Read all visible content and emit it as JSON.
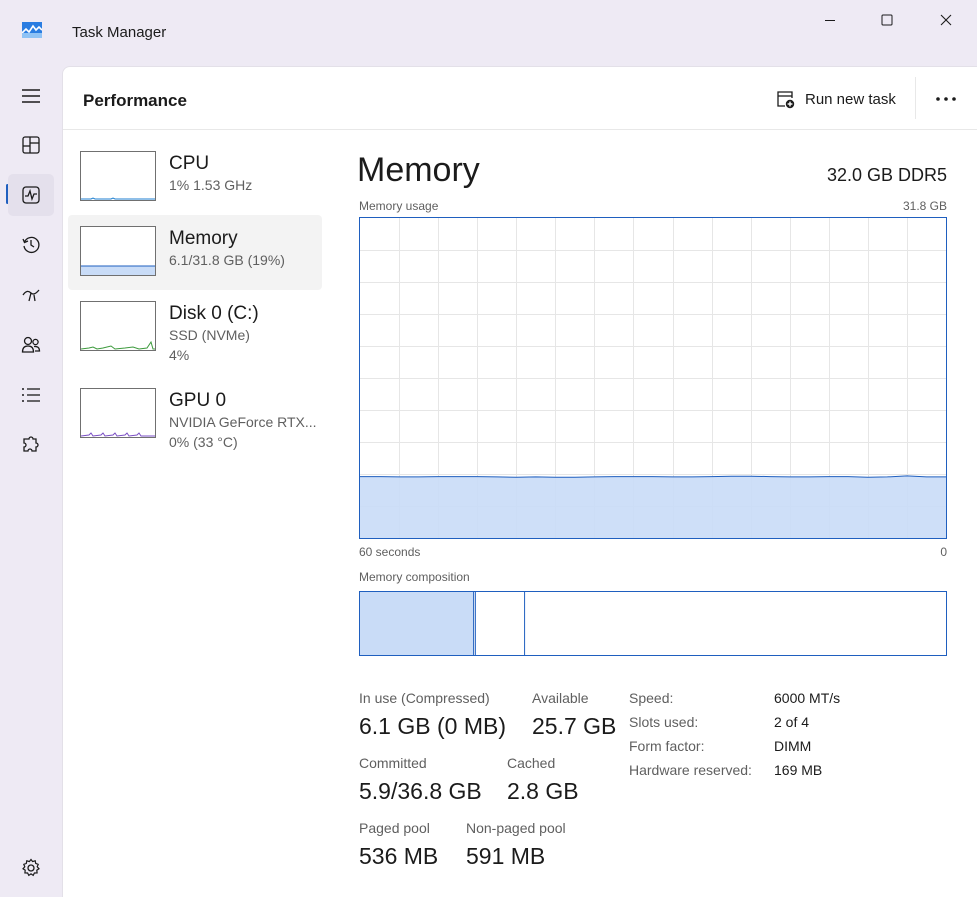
{
  "window": {
    "title": "Task Manager",
    "minimize_icon": "minimize-icon",
    "maximize_icon": "maximize-icon",
    "close_icon": "close-icon"
  },
  "nav": {
    "items": [
      {
        "name": "menu",
        "icon": "hamburger-icon"
      },
      {
        "name": "processes",
        "icon": "processes-icon"
      },
      {
        "name": "performance",
        "icon": "performance-icon",
        "active": true
      },
      {
        "name": "app-history",
        "icon": "history-icon"
      },
      {
        "name": "startup-apps",
        "icon": "startup-icon"
      },
      {
        "name": "users",
        "icon": "users-icon"
      },
      {
        "name": "details",
        "icon": "details-list-icon"
      },
      {
        "name": "services",
        "icon": "services-puzzle-icon"
      },
      {
        "name": "settings",
        "icon": "gear-icon"
      }
    ]
  },
  "header": {
    "title": "Performance",
    "run_new_task": "Run new task",
    "more_icon": "more-ellipsis-icon"
  },
  "resources": [
    {
      "name": "CPU",
      "sub1": "1% 1.53 GHz",
      "sub2": ""
    },
    {
      "name": "Memory",
      "sub1": "6.1/31.8 GB (19%)",
      "sub2": "",
      "selected": true
    },
    {
      "name": "Disk 0 (C:)",
      "sub1": "SSD (NVMe)",
      "sub2": "4%"
    },
    {
      "name": "GPU 0",
      "sub1": "NVIDIA GeForce RTX...",
      "sub2": "0% (33 °C)"
    }
  ],
  "detail": {
    "title": "Memory",
    "spec": "32.0 GB DDR5",
    "usage_label": "Memory usage",
    "usage_max": "31.8 GB",
    "time_left": "60 seconds",
    "time_right": "0",
    "composition_label": "Memory composition",
    "accent_color": "#1f5fbf",
    "fill_color": "#c9dcf7",
    "usage_history_percent": [
      19.2,
      19.2,
      19.1,
      19.1,
      19.2,
      19.2,
      19.2,
      19.1,
      19.0,
      19.1,
      19.0,
      19.0,
      19.1,
      19.2,
      19.2,
      19.2,
      19.1,
      19.1,
      19.2,
      19.3,
      19.3,
      19.2,
      19.1,
      19.1,
      19.2,
      19.2,
      19.0,
      19.1,
      19.4,
      19.1,
      19.1
    ],
    "composition": {
      "in_use_fraction": 0.193,
      "modified_fraction": 0.003,
      "standby_fraction": 0.084
    }
  },
  "stats": {
    "in_use_label": "In use (Compressed)",
    "in_use_value": "6.1 GB (0 MB)",
    "available_label": "Available",
    "available_value": "25.7 GB",
    "committed_label": "Committed",
    "committed_value": "5.9/36.8 GB",
    "cached_label": "Cached",
    "cached_value": "2.8 GB",
    "paged_label": "Paged pool",
    "paged_value": "536 MB",
    "nonpaged_label": "Non-paged pool",
    "nonpaged_value": "591 MB"
  },
  "specs": [
    {
      "label": "Speed:",
      "value": "6000 MT/s"
    },
    {
      "label": "Slots used:",
      "value": "2 of 4"
    },
    {
      "label": "Form factor:",
      "value": "DIMM"
    },
    {
      "label": "Hardware reserved:",
      "value": "169 MB"
    }
  ]
}
